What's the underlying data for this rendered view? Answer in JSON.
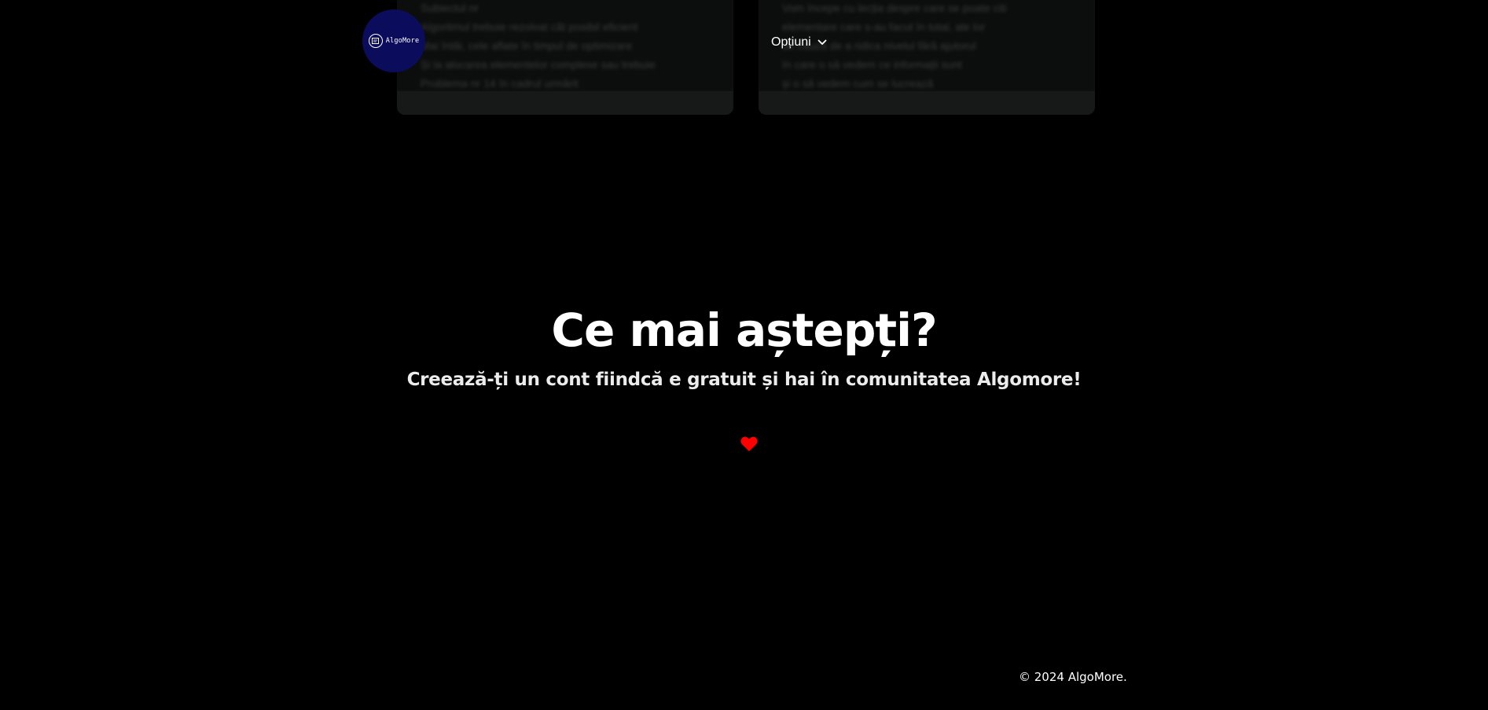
{
  "cards": {
    "left_lines": [
      "Subiectul nr",
      "Algoritmul trebuie rezolvat cât posibil eficient",
      "Mai întâi, cele aflate în timpul de optimizare",
      "Și la alocarea elementelor complexe sau trebuie",
      "Problema nr 14 în cadrul urmărit"
    ],
    "right_lines": [
      "Vom începe cu lecția despre care se poate citi",
      "elementare care s-au facut în total, ale lor",
      "de cauză de a ridica nivelul fără ajutorul",
      "în care o să vedem ce informații sunt",
      "și o să vedem cum se lucrează"
    ]
  },
  "header": {
    "logo_text": "AlgoMore",
    "options_label": "Opțiuni"
  },
  "hero": {
    "title": "Ce mai aștepți?",
    "subtitle": "Creează-ți un cont fiindcă e gratuit și hai în comunitatea Algomore!"
  },
  "footer": {
    "copyright": "© 2024 AlgoMore."
  },
  "colors": {
    "background": "#000000",
    "logo_bg": "#0b0d5c",
    "heart": "#ff0000",
    "card_bg": "#131414"
  }
}
